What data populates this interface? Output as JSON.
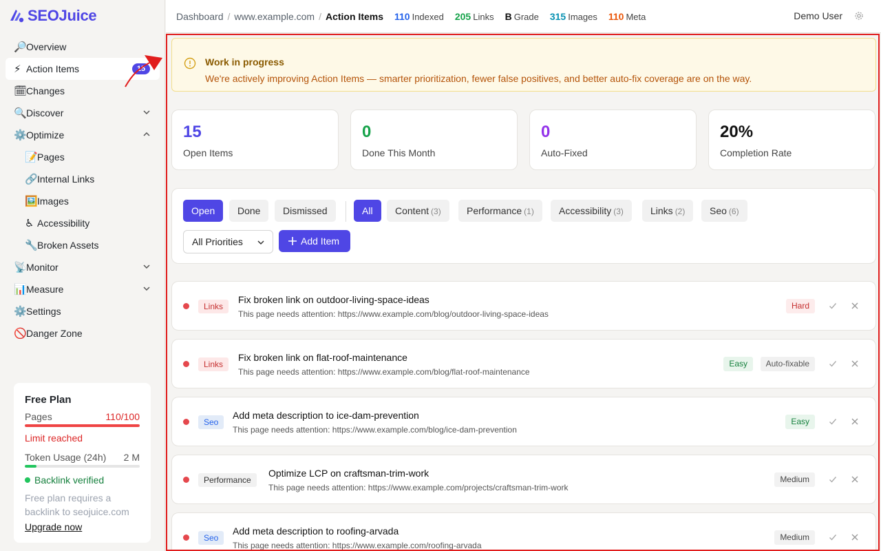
{
  "brand": {
    "name": "SEOJuice"
  },
  "sidebar": {
    "items": [
      {
        "emoji": "🔎",
        "label": "Overview"
      },
      {
        "emoji": "⚡",
        "label": "Action Items",
        "badge": "15"
      },
      {
        "emoji": "🗓",
        "label": "Changes"
      },
      {
        "emoji": "🔍",
        "label": "Discover"
      },
      {
        "emoji": "⚙️",
        "label": "Optimize"
      },
      {
        "emoji": "📝",
        "label": "Pages"
      },
      {
        "emoji": "🔗",
        "label": "Internal Links"
      },
      {
        "emoji": "🖼️",
        "label": "Images"
      },
      {
        "emoji": "♿",
        "label": "Accessibility"
      },
      {
        "emoji": "🔧",
        "label": "Broken Assets"
      },
      {
        "emoji": "📡",
        "label": "Monitor"
      },
      {
        "emoji": "📊",
        "label": "Measure"
      },
      {
        "emoji": "⚙️",
        "label": "Settings"
      },
      {
        "emoji": "🚫",
        "label": "Danger Zone"
      }
    ]
  },
  "plan": {
    "title": "Free Plan",
    "pages_label": "Pages",
    "pages_value": "110/100",
    "pages_fraction": 1.0,
    "limit_text": "Limit reached",
    "token_label": "Token Usage (24h)",
    "token_value": "2 M",
    "token_fraction": 0.1,
    "verified_text": "Backlink verified",
    "note": "Free plan requires a backlink to seojuice.com",
    "upgrade_label": "Upgrade now"
  },
  "topbar": {
    "crumbs": [
      "Dashboard",
      "www.example.com",
      "Action Items"
    ],
    "stats": [
      {
        "value": "110",
        "label": "Indexed",
        "color": "#2563eb"
      },
      {
        "value": "205",
        "label": "Links",
        "color": "#16a34a"
      },
      {
        "value": "B",
        "label": "Grade",
        "color": "#111111"
      },
      {
        "value": "315",
        "label": "Images",
        "color": "#0891b2"
      },
      {
        "value": "110",
        "label": "Meta",
        "color": "#ea580c"
      }
    ],
    "user": "Demo User"
  },
  "banner": {
    "title": "Work in progress",
    "text": "We're actively improving Action Items — smarter prioritization, fewer false positives, and better auto-fix coverage are on the way."
  },
  "cards": [
    {
      "value": "15",
      "label": "Open Items",
      "color": "#4f46e5"
    },
    {
      "value": "0",
      "label": "Done This Month",
      "color": "#16a34a"
    },
    {
      "value": "0",
      "label": "Auto-Fixed",
      "color": "#9333ea"
    },
    {
      "value": "20%",
      "label": "Completion Rate",
      "color": "#111111"
    }
  ],
  "filters": {
    "status": [
      "Open",
      "Done",
      "Dismissed"
    ],
    "categories": [
      {
        "label": "All",
        "count": ""
      },
      {
        "label": "Content",
        "count": "(3)"
      },
      {
        "label": "Performance",
        "count": "(1)"
      },
      {
        "label": "Accessibility",
        "count": "(3)"
      },
      {
        "label": "Links",
        "count": "(2)"
      },
      {
        "label": "Seo",
        "count": "(6)"
      }
    ],
    "priority_select": "All Priorities",
    "add_label": "Add Item"
  },
  "items": [
    {
      "tag": "Links",
      "title": "Fix broken link on outdoor-living-space-ideas",
      "desc": "This page needs attention: https://www.example.com/blog/outdoor-living-space-ideas",
      "badges": [
        "Hard"
      ]
    },
    {
      "tag": "Links",
      "title": "Fix broken link on flat-roof-maintenance",
      "desc": "This page needs attention: https://www.example.com/blog/flat-roof-maintenance",
      "badges": [
        "Easy",
        "Auto-fixable"
      ]
    },
    {
      "tag": "Seo",
      "title": "Add meta description to ice-dam-prevention",
      "desc": "This page needs attention: https://www.example.com/blog/ice-dam-prevention",
      "badges": [
        "Easy"
      ]
    },
    {
      "tag": "Performance",
      "title": "Optimize LCP on craftsman-trim-work",
      "desc": "This page needs attention: https://www.example.com/projects/craftsman-trim-work",
      "badges": [
        "Medium"
      ]
    },
    {
      "tag": "Seo",
      "title": "Add meta description to roofing-arvada",
      "desc": "This page needs attention: https://www.example.com/roofing-arvada",
      "badges": [
        "Medium"
      ]
    }
  ]
}
